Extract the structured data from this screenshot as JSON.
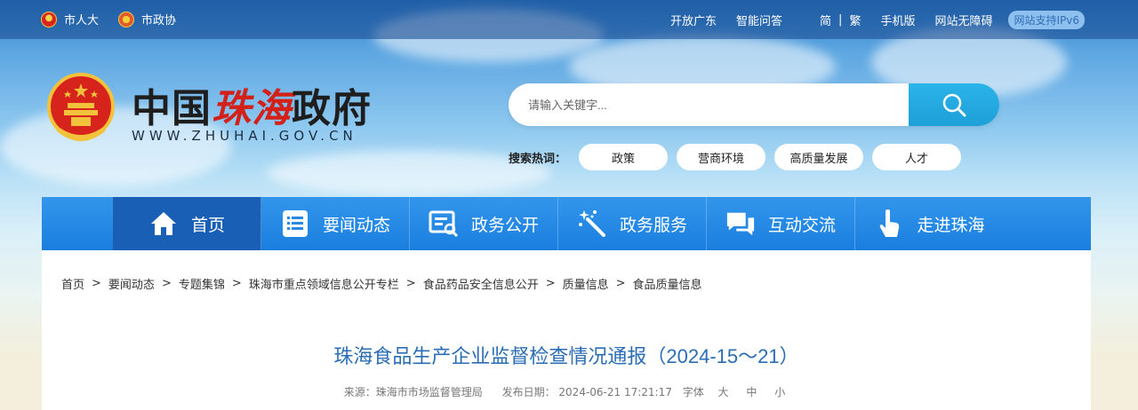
{
  "topbar": {
    "left_links": [
      {
        "label": "市人大",
        "icon": "npc-emblem-icon"
      },
      {
        "label": "市政协",
        "icon": "cppcc-emblem-icon"
      }
    ],
    "right_links": [
      "开放广东",
      "智能问答"
    ],
    "lang_simplified": "简",
    "lang_separator": "|",
    "lang_traditional": "繁",
    "mobile": "手机版",
    "accessibility": "网站无障碍",
    "ipv6": "网站支持IPv6"
  },
  "logo": {
    "title_part1": "中国",
    "title_part2": "珠海",
    "title_part3": "政府",
    "url": "WWW.ZHUHAI.GOV.CN"
  },
  "search": {
    "placeholder": "请输入关键字...",
    "hot_label": "搜索热词：",
    "hot_tags": [
      "政策",
      "营商环境",
      "高质量发展",
      "人才"
    ]
  },
  "nav": {
    "items": [
      {
        "label": "首页",
        "icon": "home-icon"
      },
      {
        "label": "要闻动态",
        "icon": "news-list-icon"
      },
      {
        "label": "政务公开",
        "icon": "document-search-icon"
      },
      {
        "label": "政务服务",
        "icon": "magic-wand-icon"
      },
      {
        "label": "互动交流",
        "icon": "chat-bubbles-icon"
      },
      {
        "label": "走进珠海",
        "icon": "hand-pointer-icon"
      }
    ]
  },
  "breadcrumb": [
    "首页",
    "要闻动态",
    "专题集锦",
    "珠海市重点领域信息公开专栏",
    "食品药品安全信息公开",
    "质量信息",
    "食品质量信息"
  ],
  "breadcrumb_separator": ">",
  "article": {
    "title": "珠海食品生产企业监督检查情况通报（2024-15～21）",
    "source": "来源：珠海市市场监督管理局",
    "date": "发布日期：  2024-06-21 17:21:17",
    "font_label": "字体",
    "font_large": "大",
    "font_medium": "中",
    "font_small": "小"
  },
  "colors": {
    "nav_blue": "#1a7ede",
    "nav_active": "#1a5fb6",
    "title_blue": "#2a6db5",
    "search_button": "#1e9fd8"
  }
}
